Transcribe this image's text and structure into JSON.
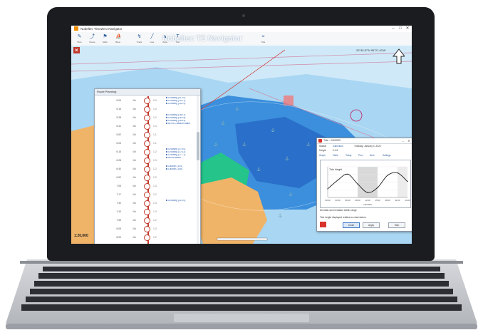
{
  "app": {
    "title": "Nobeltec TimeZero Navigator",
    "watermark": "Nobeltec TZ Navigator",
    "north_readout": "29°45.87'N 95°21.40'W",
    "scale": "1:20,000"
  },
  "window_controls": {
    "minimize": "–",
    "maximize": "□",
    "close": "✕"
  },
  "toolbar": {
    "buttons": [
      {
        "label": "Plan",
        "icon": "plan-icon"
      },
      {
        "label": "Route",
        "icon": "route-icon"
      },
      {
        "label": "Mark",
        "icon": "mark-icon"
      },
      {
        "label": "Boat",
        "icon": "boat-icon"
      },
      {
        "label": "Track",
        "icon": "track-icon"
      },
      {
        "label": "Line",
        "icon": "line-icon"
      },
      {
        "label": "Area",
        "icon": "area-icon"
      },
      {
        "label": "Text",
        "icon": "text-icon"
      },
      {
        "label": "Tide",
        "icon": "tide-icon"
      }
    ]
  },
  "route_panel": {
    "title": "Route Planning",
    "rows": [
      {
        "time": "5:06",
        "speed": "6kt",
        "dist": "0.0",
        "events": [
          "Crossing (213.0)",
          "Crossing (192.1)",
          "Crossing (102.9)"
        ]
      },
      {
        "time": "5:16",
        "speed": "6kt",
        "dist": "1.0",
        "events": []
      },
      {
        "time": "5:28",
        "speed": "6kt",
        "dist": "1.2",
        "events": [
          "Crossing (160.1)",
          "Crossing (162.8)",
          "Crossing (163.4)"
        ]
      },
      {
        "time": "5:41",
        "speed": "6kt",
        "dist": "1.4",
        "events": [
          "ARPA Collision Alarm"
        ]
      },
      {
        "time": "5:52",
        "speed": "6kt",
        "dist": "1.1",
        "events": []
      },
      {
        "time": "6:03",
        "speed": "6kt",
        "dist": "1.1",
        "events": []
      },
      {
        "time": "6:15",
        "speed": "6kt",
        "dist": "1.2",
        "events": [
          "Crossing (175.0)",
          "Crossing (176.2)",
          "Crossing (177.1)"
        ]
      },
      {
        "time": "6:28",
        "speed": "6kt",
        "dist": "1.3",
        "events": [
          "ARPA Alarm"
        ]
      },
      {
        "time": "6:40",
        "speed": "6kt",
        "dist": "1.2",
        "events": [
          "Caution (104)",
          "Caution (106)"
        ]
      },
      {
        "time": "6:52",
        "speed": "6kt",
        "dist": "1.2",
        "events": []
      },
      {
        "time": "7:05",
        "speed": "6kt",
        "dist": "1.3",
        "events": []
      },
      {
        "time": "7:17",
        "speed": "6kt",
        "dist": "1.2",
        "events": []
      },
      {
        "time": "7:30",
        "speed": "6kt",
        "dist": "1.3",
        "events": [
          "Crossing (210.0)"
        ]
      },
      {
        "time": "7:43",
        "speed": "6kt",
        "dist": "1.3",
        "events": []
      },
      {
        "time": "7:55",
        "speed": "6kt",
        "dist": "1.2",
        "events": []
      },
      {
        "time": "8:08",
        "speed": "6kt",
        "dist": "1.3",
        "events": []
      },
      {
        "time": "8:20",
        "speed": "6kt",
        "dist": "1.2",
        "events": []
      }
    ]
  },
  "tide": {
    "title": "Tide - 1/4/2022",
    "station_label": "Station",
    "station_value": "Galveston",
    "date": "Tuesday, January 4, 2022",
    "height_label": "Height",
    "height_value": "0.4 ft",
    "toolbar": [
      "Graph",
      "Table",
      "Today",
      "Prev",
      "Next",
      "Settings"
    ],
    "graph_label": "Tide Height",
    "x_ticks": [
      "00:00",
      "03:00",
      "06:00",
      "09:00",
      "12:00",
      "15:00",
      "18:00",
      "21:00",
      "24:00"
    ],
    "x_center_label": "1/4/2022",
    "footer1": "No tidal current station within range",
    "footer2": "Tide height displayed relative to chart datum",
    "buttons": [
      "Close",
      "Apply",
      "Help"
    ]
  },
  "chart_data": {
    "type": "line",
    "x": [
      0,
      3,
      6,
      9,
      12,
      15,
      18,
      21,
      24
    ],
    "series": [
      {
        "values": [
          0.2,
          0.9,
          1.4,
          0.6,
          -0.1,
          0.3,
          1.3,
          1.5,
          0.8
        ]
      }
    ],
    "ylim": [
      -0.5,
      2.0
    ]
  },
  "colors": {
    "bezel": "#1b1c1f",
    "deep_water": "#2f7ed6",
    "shallow_water": "#9fd0ef",
    "land": "#f0b469",
    "green_shoal": "#24c48a",
    "route_red": "#c0392b",
    "accent": "#2a5d9f"
  }
}
